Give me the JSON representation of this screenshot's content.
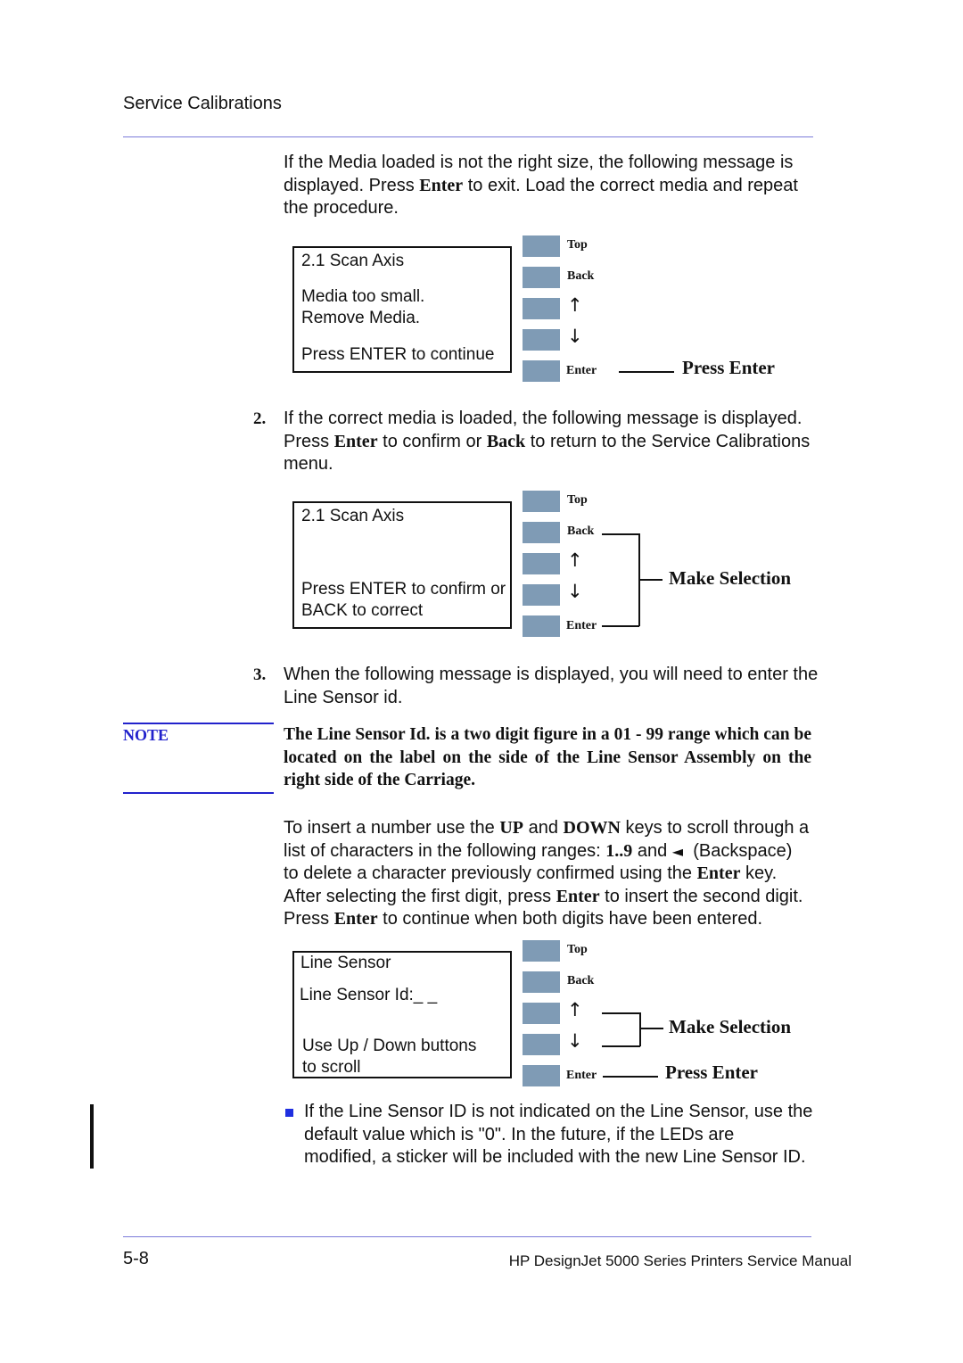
{
  "header": {
    "section_title": "Service Calibrations"
  },
  "intro": {
    "line1": "If the Media loaded is not the right size, the following message is",
    "line2_pre": "displayed. Press ",
    "line2_bold": "Enter",
    "line2_post": " to exit.  Load the correct media and repeat",
    "line3": "the procedure."
  },
  "keys": {
    "top": "Top",
    "back": "Back",
    "up_arrow": "↑",
    "down_arrow": "↓",
    "enter": "Enter"
  },
  "panel1": {
    "lcd_lines": [
      "2.1 Scan Axis",
      "Media too small.",
      "Remove Media.",
      "Press ENTER to continue"
    ],
    "callout": "Press Enter"
  },
  "step2": {
    "number": "2.",
    "line1": "If the correct media is loaded, the following message is displayed.",
    "line2_pre": "Press ",
    "line2_bold1": "Enter",
    "line2_mid": " to confirm or ",
    "line2_bold2": "Back",
    "line2_post": " to return to the Service Calibrations",
    "line3": "menu."
  },
  "panel2": {
    "lcd_lines": [
      "2.1 Scan Axis",
      "Press ENTER to confirm or",
      "BACK to correct"
    ],
    "callout": "Make Selection"
  },
  "step3": {
    "number": "3.",
    "line1": "When the following message is displayed, you will need to enter the",
    "line2": "Line Sensor id."
  },
  "note": {
    "label": "NOTE",
    "text": "The Line Sensor Id. is a two digit figure in a 01 - 99 range which can be located on the label on the side of the Line Sensor Assembly on the right side of the Carriage."
  },
  "instructions": {
    "l1_pre": "To insert a number use the ",
    "l1_b1": "UP",
    "l1_mid": " and ",
    "l1_b2": "DOWN",
    "l1_post": " keys to scroll through a",
    "l2_pre": "list of characters in the following ranges: ",
    "l2_b": "1..9",
    "l2_mid": " and ",
    "l2_icon": "◄",
    "l2_post": "  (Backspace)",
    "l3_pre": "to delete a character previously confirmed using the ",
    "l3_b": "Enter",
    "l3_post": " key.",
    "l4_pre": "After selecting the first digit, press ",
    "l4_b": "Enter",
    "l4_post": " to insert the second digit.",
    "l5_pre": "Press ",
    "l5_b": "Enter",
    "l5_post": " to continue when both digits have been entered."
  },
  "panel3": {
    "lcd_lines": [
      "Line Sensor",
      "Line Sensor Id:_ _",
      "Use Up / Down buttons",
      "to scroll"
    ],
    "callout_select": "Make Selection",
    "callout_enter": "Press Enter"
  },
  "bullet_note": {
    "line1": "If the Line Sensor ID is not indicated on the Line Sensor, use the",
    "line2": "default value which is \"0\". In the future, if the LEDs are",
    "line3": "modified, a sticker will be included with the new Line Sensor ID."
  },
  "footer": {
    "page_number": "5-8",
    "manual_title": "HP DesignJet 5000 Series Printers Service Manual"
  }
}
